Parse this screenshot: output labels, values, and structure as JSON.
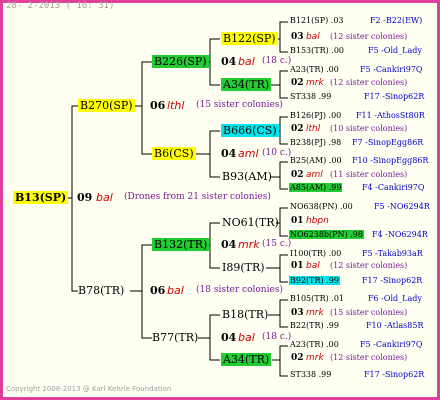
{
  "header": "28-  2-2013 ( 16: 31)",
  "footer": "Copyright 2008-2013 @ Karl Kehrle Foundation",
  "colors": {
    "frame": "#e0409c",
    "yellow": "#ffff00",
    "green": "#22cc33",
    "cyan": "#00e5ee",
    "breed": "#cc0000",
    "sisters": "#7a1a9a",
    "loc": "#0000cc"
  },
  "root": {
    "id": "B13(SP)",
    "gen": "09",
    "breed": "bal",
    "note": "(Drones from 21 sister colonies)"
  },
  "sire": {
    "id": "B270(SP)",
    "gen": "06",
    "breed": "lthl",
    "note": "(15 sister colonies)"
  },
  "dam": {
    "id": "B78(TR)",
    "gen": "06",
    "breed": "bal",
    "note": "(18 sister colonies)"
  },
  "ss": {
    "id": "B226(SP)",
    "gen": "04",
    "breed": "bal",
    "note": "(18 c.)"
  },
  "sd": {
    "id": "B6(CS)",
    "gen": "04",
    "breed": "aml",
    "note": "(10 c.)"
  },
  "ds": {
    "id": "B132(TR)",
    "gen": "04",
    "breed": "mrk",
    "note": "(15 c.)"
  },
  "dd": {
    "id": "B77(TR)",
    "gen": "04",
    "breed": "bal",
    "note": "(18 c.)"
  },
  "g3": [
    {
      "top": "B122(SP)",
      "bottom": "A34(TR)"
    },
    {
      "top": "B666(CS)",
      "bottom": "B93(AM)"
    },
    {
      "top": "NO61(TR)",
      "bottom": "I89(TR)"
    },
    {
      "top": "B18(TR)",
      "bottom": "A34(TR)"
    }
  ],
  "g4": [
    {
      "gen": "03",
      "breed": "bal",
      "note": "(12 sister colonies)"
    },
    {
      "gen": "02",
      "breed": "mrk",
      "note": "(12 sister colonies)"
    },
    {
      "gen": "02",
      "breed": "lthl",
      "note": "(10 sister colonies)"
    },
    {
      "gen": "02",
      "breed": "aml",
      "note": "(11 sister colonies)"
    },
    {
      "gen": "01",
      "breed": "hbpn",
      "note": ""
    },
    {
      "gen": "01",
      "breed": "bal",
      "note": "(12 sister colonies)"
    },
    {
      "gen": "03",
      "breed": "mrk",
      "note": "(15 sister colonies)"
    },
    {
      "gen": "02",
      "breed": "mrk",
      "note": "(12 sister colonies)"
    }
  ],
  "g5": [
    {
      "id": "B121(SP) .03",
      "loc": "F2 -B22(EW)"
    },
    {
      "id": "B153(TR) .00",
      "loc": "F5 -Old_Lady"
    },
    {
      "id": "A23(TR) .00",
      "loc": "F5 -Cankiri97Q"
    },
    {
      "id": "ST338 .99",
      "loc": "F17 -Sinop62R"
    },
    {
      "id": "B126(PJ) .00",
      "loc": "F11 -AthosSt80R"
    },
    {
      "id": "B238(PJ) .98",
      "loc": "F7 -SinopEgg86R"
    },
    {
      "id": "B25(AM) .00",
      "loc": "F10 -SinopEgg86R"
    },
    {
      "id": "A85(AM) .99",
      "loc": "F4 -Cankiri97Q"
    },
    {
      "id": "NO638(PN) .00",
      "loc": "F5 -NO6294R"
    },
    {
      "id": "NO6238b(PN) .98",
      "loc": "F4 -NO6294R"
    },
    {
      "id": "I100(TR) .00",
      "loc": "F5 -Takab93aR"
    },
    {
      "id": "B92(TR) .99",
      "loc": "F17 -Sinop62R"
    },
    {
      "id": "B105(TR) .01",
      "loc": "F6 -Old_Lady"
    },
    {
      "id": "B22(TR) .99",
      "loc": "F10 -Atlas85R"
    },
    {
      "id": "A23(TR) .00",
      "loc": "F5 -Cankiri97Q"
    },
    {
      "id": "ST338 .99",
      "loc": "F17 -Sinop62R"
    }
  ]
}
